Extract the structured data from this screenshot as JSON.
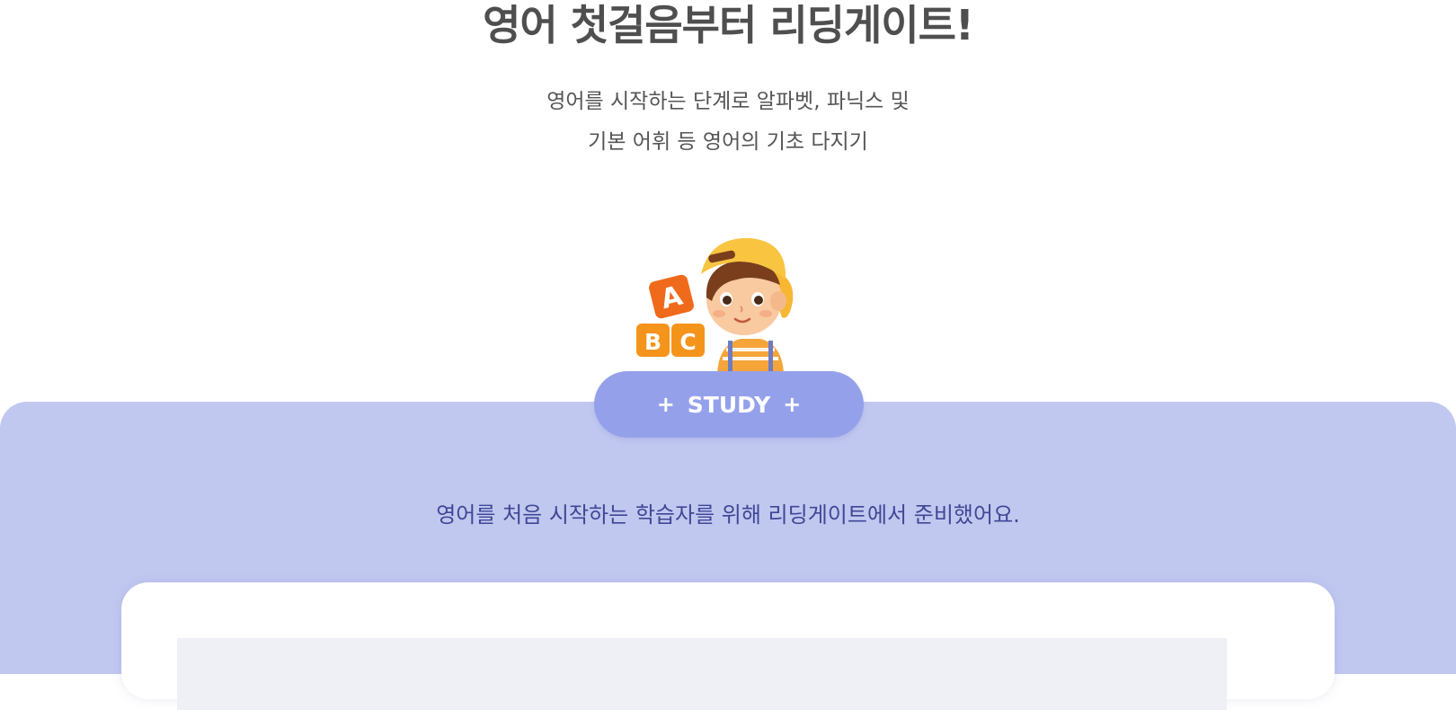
{
  "hero": {
    "title": "영어 첫걸음부터 리딩게이트!",
    "desc_line1": "영어를 시작하는 단계로 알파벳, 파닉스 및",
    "desc_line2": "기본 어휘 등 영어의 기초 다지기"
  },
  "illustration": {
    "blocks": [
      "A",
      "B",
      "C"
    ],
    "colors": {
      "block_a": "#f06a1b",
      "block_bc": "#f5941a",
      "cap": "#f9c440",
      "shirt": "#f5a53a"
    }
  },
  "study": {
    "plus_left": "+",
    "label": "STUDY",
    "plus_right": "+",
    "description": "영어를 처음 시작하는 학습자를 위해 리딩게이트에서 준비했어요."
  },
  "colors": {
    "band": "#c1c8f0",
    "pill": "#94a1ea",
    "description_text": "#3f4796"
  }
}
